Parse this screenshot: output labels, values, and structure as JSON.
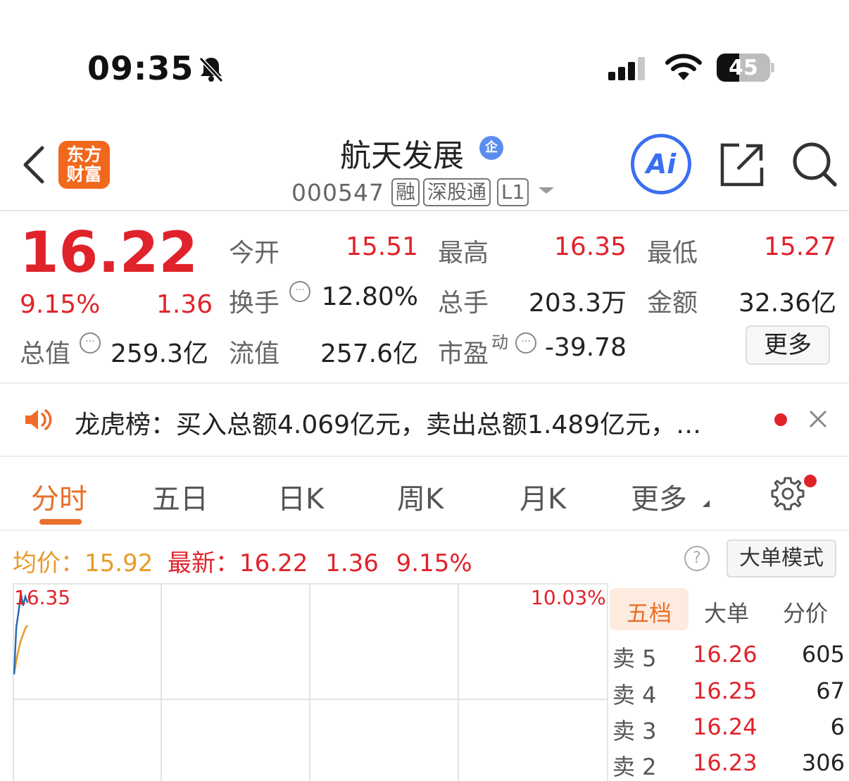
{
  "status_bar": {
    "time": "09:35",
    "battery": "45"
  },
  "header": {
    "logo_line1": "东方",
    "logo_line2": "财富",
    "stock_name": "航天发展",
    "enterprise_badge": "企",
    "stock_code": "000547",
    "tags": [
      "融",
      "深股通",
      "L1"
    ],
    "ai_label": "Ai"
  },
  "quote": {
    "price": "16.22",
    "change_pct": "9.15%",
    "change": "1.36",
    "fields": {
      "open_label": "今开",
      "open_value": "15.51",
      "high_label": "最高",
      "high_value": "16.35",
      "low_label": "最低",
      "low_value": "15.27",
      "turnover_label": "换手",
      "turnover_value": "12.80%",
      "volume_label": "总手",
      "volume_value": "203.3万",
      "amount_label": "金额",
      "amount_value": "32.36亿",
      "mktcap_label": "总值",
      "mktcap_value": "259.3亿",
      "float_label": "流值",
      "float_value": "257.6亿",
      "pe_label": "市盈",
      "pe_superscript": "动",
      "pe_value": "-39.78"
    },
    "more_button": "更多"
  },
  "news": {
    "text": "龙虎榜：买入总额4.069亿元，卖出总额1.489亿元，…"
  },
  "tabs": {
    "items": [
      "分时",
      "五日",
      "日K",
      "周K",
      "月K",
      "更多"
    ],
    "active": "分时"
  },
  "info_line": {
    "avg_label": "均价：",
    "avg_value": "15.92",
    "latest_label": "最新：",
    "latest_value": "16.22",
    "latest_change": "1.36",
    "latest_pct": "9.15%",
    "big_order_mode": "大单模式"
  },
  "chart": {
    "high_label": "16.35",
    "pct_label": "10.03%"
  },
  "chart_data": {
    "type": "line",
    "ylim": [
      14.75,
      16.35
    ],
    "series": [
      {
        "name": "最新",
        "color": "#2b6cb0",
        "x": [
          0,
          1,
          2,
          3,
          4,
          5,
          6
        ],
        "values": [
          15.27,
          15.9,
          16.1,
          16.35,
          16.18,
          16.3,
          16.22
        ]
      },
      {
        "name": "均价",
        "color": "#e89a2a",
        "x": [
          0,
          1,
          2,
          3,
          4,
          5,
          6
        ],
        "values": [
          15.27,
          15.45,
          15.6,
          15.72,
          15.8,
          15.88,
          15.92
        ]
      }
    ]
  },
  "order_book": {
    "tabs": [
      "五档",
      "大单",
      "分价"
    ],
    "active_tab": "五档",
    "rows": [
      {
        "label": "卖 5",
        "price": "16.26",
        "volume": "605"
      },
      {
        "label": "卖 4",
        "price": "16.25",
        "volume": "67"
      },
      {
        "label": "卖 3",
        "price": "16.24",
        "volume": "6"
      },
      {
        "label": "卖 2",
        "price": "16.23",
        "volume": "306"
      }
    ]
  },
  "colors": {
    "up_red": "#e0232b",
    "accent_orange": "#e8702a",
    "ai_blue": "#3a6ff2",
    "avg_orange": "#e89a2a"
  }
}
